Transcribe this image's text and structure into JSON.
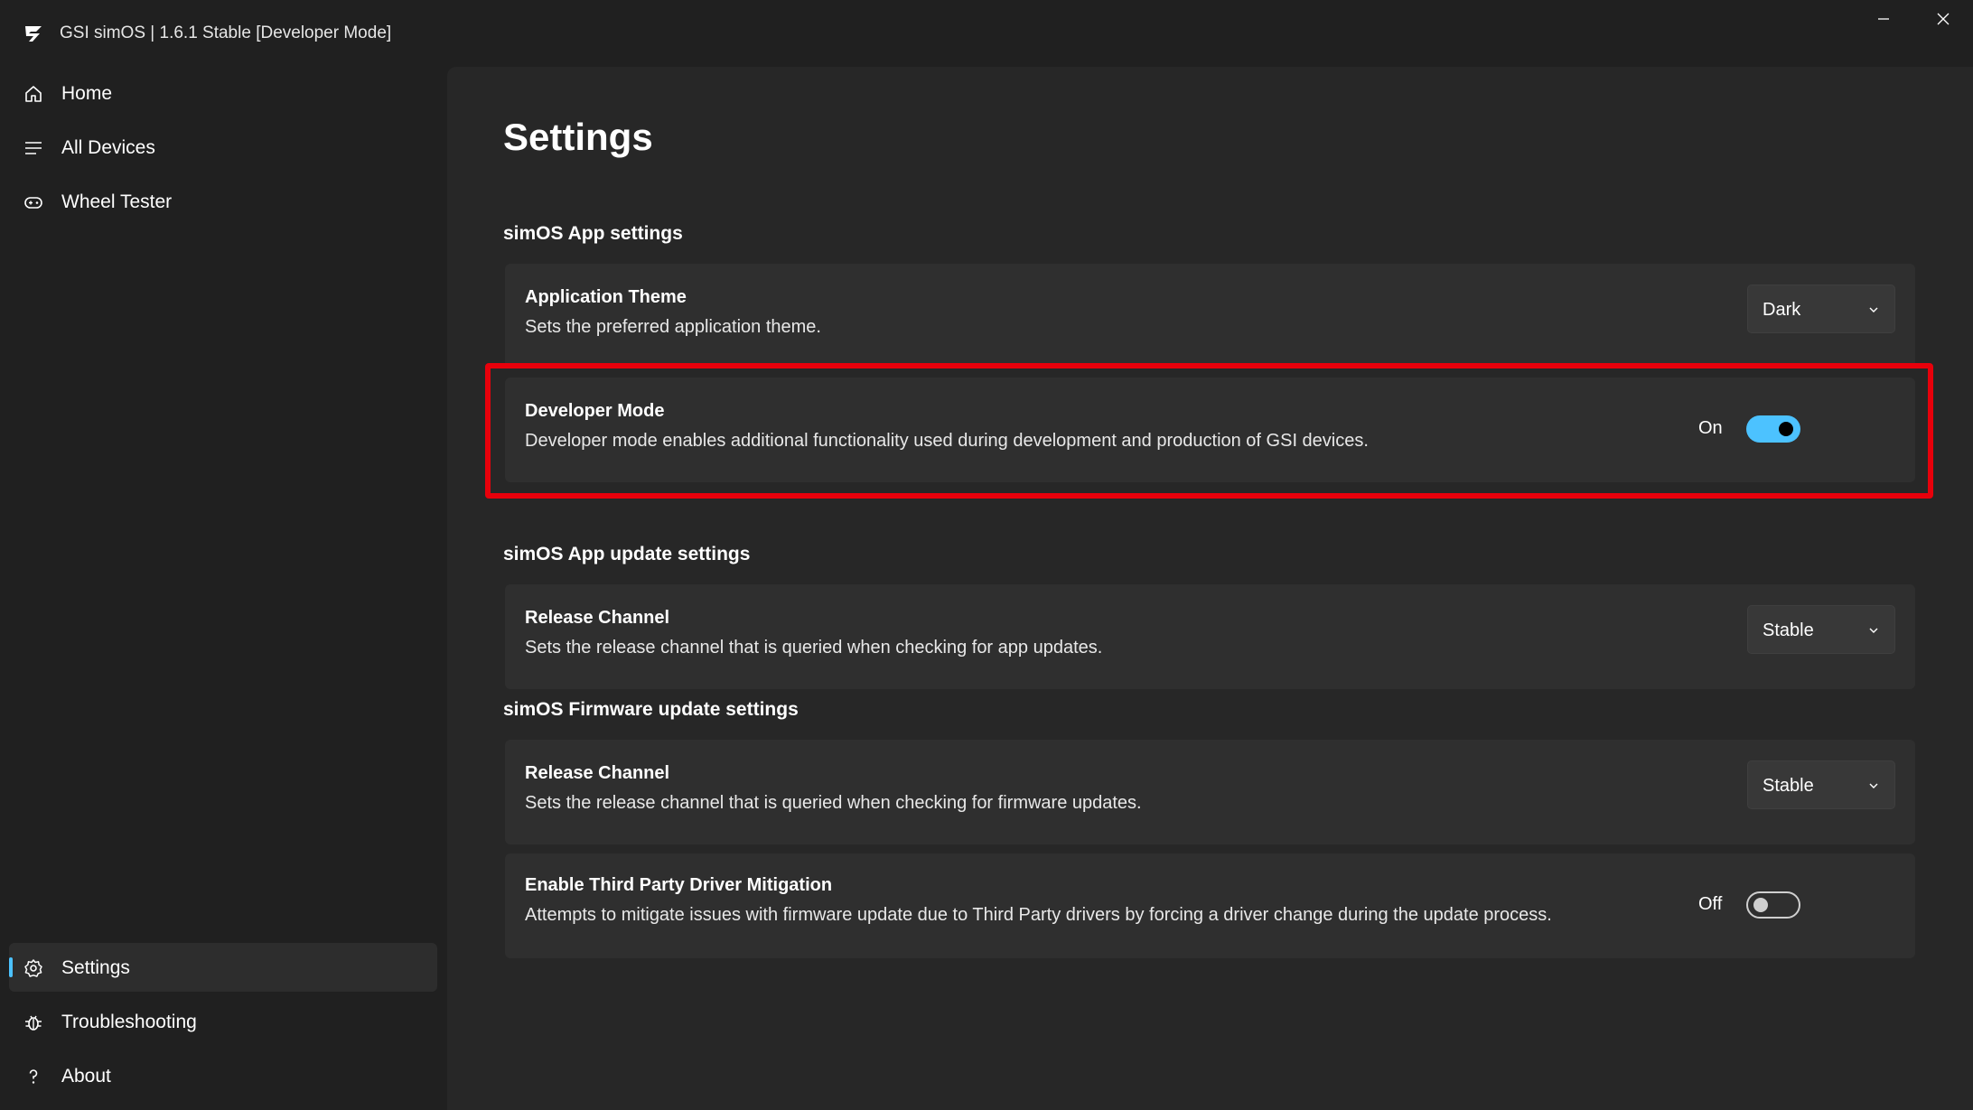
{
  "window": {
    "title": "GSI simOS | 1.6.1 Stable [Developer Mode]",
    "logo_icon": "gsi-logo-icon",
    "minimize_icon": "minimize-icon",
    "close_icon": "close-icon"
  },
  "sidebar": {
    "top_items": [
      {
        "label": "Home",
        "icon": "home-icon"
      },
      {
        "label": "All Devices",
        "icon": "list-icon"
      },
      {
        "label": "Wheel Tester",
        "icon": "gamepad-icon"
      }
    ],
    "bottom_items": [
      {
        "label": "Settings",
        "icon": "gear-icon",
        "active": true
      },
      {
        "label": "Troubleshooting",
        "icon": "bug-icon"
      },
      {
        "label": "About",
        "icon": "question-icon"
      }
    ],
    "accent_color": "#4cc2ff"
  },
  "settings": {
    "page_title": "Settings",
    "app_settings": {
      "header": "simOS App settings",
      "theme": {
        "title": "Application Theme",
        "description": "Sets the preferred application theme.",
        "value": "Dark"
      },
      "developer_mode": {
        "title": "Developer Mode",
        "description": "Developer mode enables additional functionality used during development and production of GSI devices.",
        "state_label": "On",
        "enabled": true
      }
    },
    "app_update": {
      "header": "simOS App update settings",
      "release_channel": {
        "title": "Release Channel",
        "description": "Sets the release channel that is queried when checking for app updates.",
        "value": "Stable"
      }
    },
    "firmware_update": {
      "header": "simOS Firmware update settings",
      "release_channel": {
        "title": "Release Channel",
        "description": "Sets the release channel that is queried when checking for firmware updates.",
        "value": "Stable"
      },
      "third_party": {
        "title": "Enable Third Party Driver Mitigation",
        "description": "Attempts to mitigate issues with firmware update due to Third Party drivers by forcing a driver change during the update process.",
        "state_label": "Off",
        "enabled": false
      }
    }
  },
  "annotation": {
    "highlight_color": "#e8000b"
  }
}
